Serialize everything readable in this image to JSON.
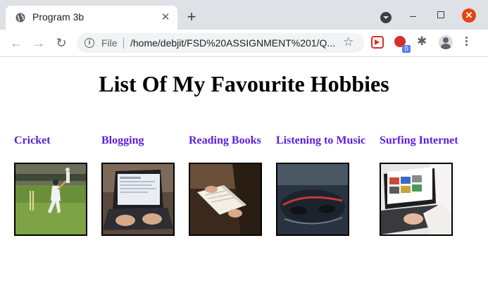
{
  "browser": {
    "tab_title": "Program 3b",
    "tab_close": "✕",
    "new_tab": "+",
    "scheme_label": "File",
    "url": "/home/debjit/FSD%20ASSIGNMENT%201/Q...",
    "extension_badge": "0",
    "win_close": "✕"
  },
  "page": {
    "heading": "List Of My Favourite Hobbies",
    "hobbies": [
      {
        "label": "Cricket"
      },
      {
        "label": "Blogging"
      },
      {
        "label": "Reading Books"
      },
      {
        "label": "Listening to Music"
      },
      {
        "label": "Surfing Internet"
      }
    ]
  },
  "colors": {
    "link": "#5a1ee0",
    "tab_bar": "#dee1e6"
  }
}
